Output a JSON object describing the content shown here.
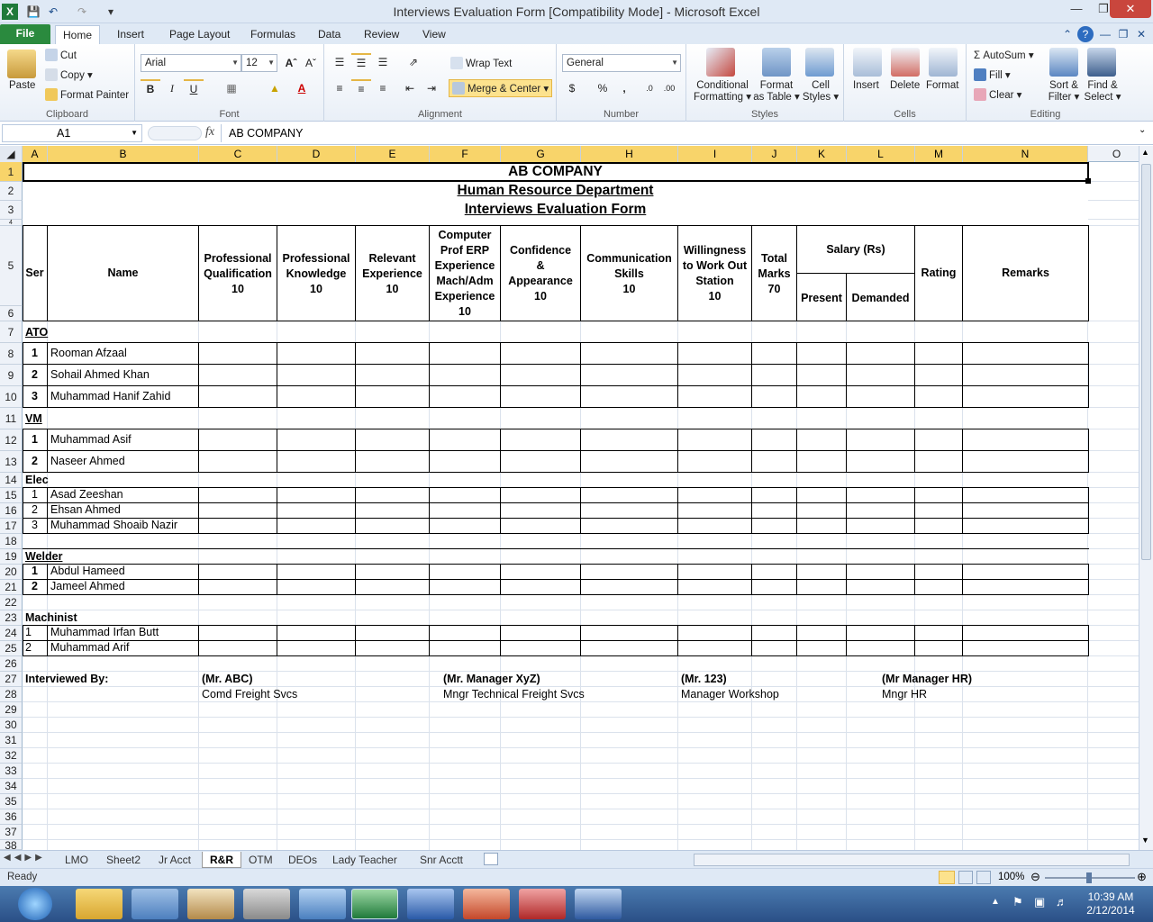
{
  "window": {
    "title": "Interviews Evaluation Form  [Compatibility Mode]  -  Microsoft Excel",
    "app_icon": "X"
  },
  "ribbon_tabs": [
    "File",
    "Home",
    "Insert",
    "Page Layout",
    "Formulas",
    "Data",
    "Review",
    "View"
  ],
  "ribbon": {
    "clipboard": {
      "label": "Clipboard",
      "paste": "Paste",
      "cut": "Cut",
      "copy": "Copy",
      "format_painter": "Format Painter"
    },
    "font": {
      "label": "Font",
      "font_name": "Arial",
      "font_size": "12",
      "bold": "B",
      "italic": "I",
      "underline": "U"
    },
    "alignment": {
      "label": "Alignment",
      "wrap_text": "Wrap Text",
      "merge_center": "Merge & Center"
    },
    "number": {
      "label": "Number",
      "format": "General",
      "currency": "$",
      "percent": "%",
      "comma": ","
    },
    "styles": {
      "label": "Styles",
      "conditional": "Conditional",
      "conditional2": "Formatting",
      "format_table": "Format",
      "format_table2": "as Table",
      "cell_styles": "Cell",
      "cell_styles2": "Styles"
    },
    "cells": {
      "label": "Cells",
      "insert": "Insert",
      "delete": "Delete",
      "format": "Format"
    },
    "editing": {
      "label": "Editing",
      "autosum": "AutoSum",
      "fill": "Fill",
      "clear": "Clear",
      "sort": "Sort &",
      "sort2": "Filter",
      "find": "Find &",
      "find2": "Select"
    }
  },
  "formula_bar": {
    "name_box": "A1",
    "fx": "fx",
    "content": "AB COMPANY"
  },
  "columns": [
    "A",
    "B",
    "C",
    "D",
    "E",
    "F",
    "G",
    "H",
    "I",
    "J",
    "K",
    "L",
    "M",
    "N",
    "O"
  ],
  "rows": [
    "1",
    "2",
    "3",
    "4",
    "5",
    "6",
    "7",
    "8",
    "9",
    "10",
    "11",
    "12",
    "13",
    "14",
    "15",
    "16",
    "17",
    "18",
    "19",
    "20",
    "21",
    "22",
    "23",
    "24",
    "25",
    "26",
    "27",
    "28",
    "29",
    "30",
    "31",
    "32",
    "33",
    "34",
    "35",
    "36",
    "37",
    "38"
  ],
  "sheet": {
    "title1": "AB COMPANY",
    "title2": "Human Resource Department",
    "title3": "Interviews Evaluation Form",
    "headers": {
      "ser": "Ser",
      "name": "Name",
      "c": [
        "Professional",
        "Qualification",
        "10"
      ],
      "d": [
        "Professional",
        "Knowledge",
        "10"
      ],
      "e": [
        "Relevant",
        "Experience",
        "10"
      ],
      "f": [
        "Computer",
        "Prof ERP",
        "Experience",
        "Mach/Adm",
        "Experience",
        "10"
      ],
      "g": [
        "Confidence",
        "&",
        "Appearance",
        "10"
      ],
      "h": [
        "Communication",
        "Skills",
        "10"
      ],
      "i": [
        "Willingness",
        "to Work Out",
        "Station",
        "10"
      ],
      "j": [
        "Total",
        "Marks",
        "70"
      ],
      "salary": "Salary (Rs)",
      "present": "Present",
      "demanded": "Demanded",
      "rating": "Rating",
      "remarks": "Remarks"
    },
    "sections": {
      "ato": "ATO",
      "vm": "VM",
      "elec": "Elec",
      "welder": "Welder",
      "machinist": "Machinist"
    },
    "ato_rows": [
      [
        "1",
        "Rooman Afzaal"
      ],
      [
        "2",
        "Sohail Ahmed Khan"
      ],
      [
        "3",
        "Muhammad Hanif Zahid"
      ]
    ],
    "vm_rows": [
      [
        "1",
        "Muhammad Asif"
      ],
      [
        "2",
        "Naseer Ahmed"
      ]
    ],
    "elec_rows": [
      [
        "1",
        "Asad Zeeshan"
      ],
      [
        "2",
        "Ehsan Ahmed"
      ],
      [
        "3",
        "Muhammad Shoaib Nazir"
      ]
    ],
    "welder_rows": [
      [
        "1",
        "Abdul Hameed"
      ],
      [
        "2",
        "Jameel Ahmed"
      ]
    ],
    "machinist_rows": [
      [
        "1",
        "Muhammad Irfan Butt"
      ],
      [
        "2",
        "Muhammad Arif"
      ]
    ],
    "footer": {
      "interviewed_by": "Interviewed By:",
      "s1_name": "(Mr. ABC)",
      "s1_title": "Comd Freight Svcs",
      "s2_name": "(Mr. Manager XyZ)",
      "s2_title": "Mngr Technical Freight Svcs",
      "s3_name": "(Mr. 123)",
      "s3_title": "Manager Workshop",
      "s4_name": "(Mr Manager HR)",
      "s4_title": "Mngr HR"
    }
  },
  "sheet_tabs": [
    "LMO",
    "Sheet2",
    "Jr Acct",
    "R&R",
    "OTM",
    "DEOs",
    "Lady Teacher",
    "Snr Acctt"
  ],
  "active_sheet": "R&R",
  "status": {
    "ready": "Ready",
    "zoom": "100%"
  },
  "taskbar": {
    "time": "10:39 AM",
    "date": "2/12/2014"
  }
}
